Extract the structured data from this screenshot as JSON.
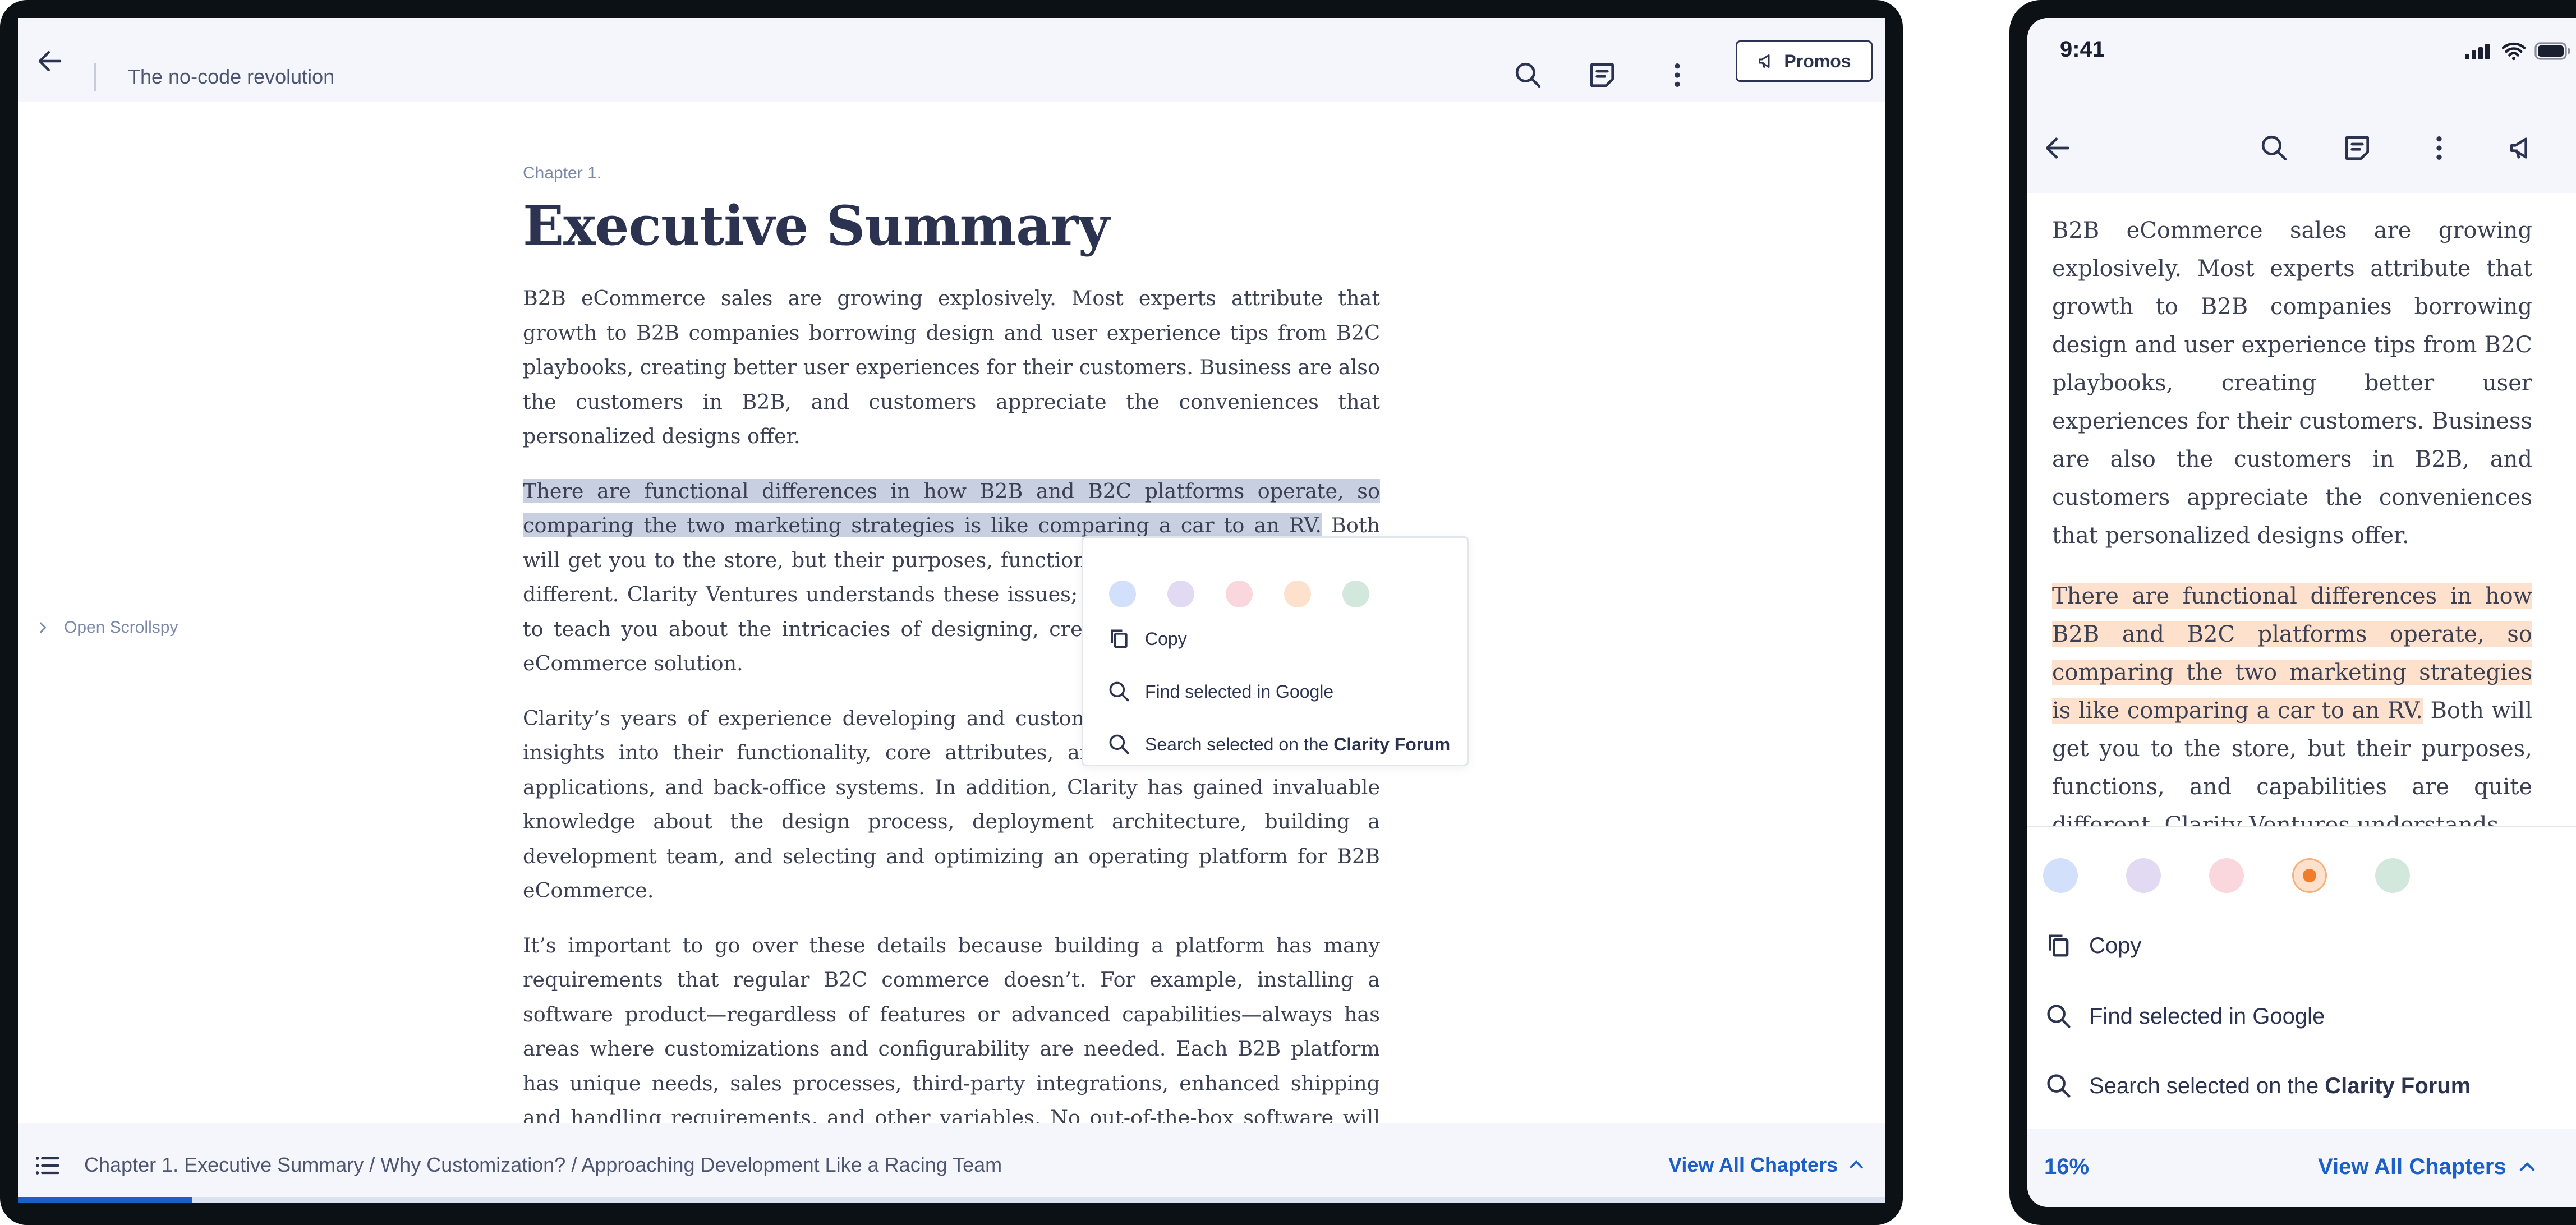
{
  "tablet": {
    "header": {
      "title": "The no-code revolution",
      "promos_label": "Promos",
      "icons": [
        "back-arrow-icon",
        "search-icon",
        "notes-icon",
        "more-vertical-icon",
        "megaphone-icon"
      ]
    },
    "scrollspy_label": "Open Scrollspy",
    "chapter_label": "Chapter 1.",
    "chapter_title": "Executive Summary",
    "paragraphs": {
      "p1": "B2B eCommerce sales are growing explosively. Most experts attribute that growth to B2B companies borrowing design and user experience tips from B2C playbooks, creating better user experiences for their customers. Business are also the customers in B2B, and customers appreciate the conveniences that personalized designs offer.",
      "p2_selected": "There are functional differences in how B2B and B2C platforms operate, so comparing the two marketing strategies is like comparing a car to an RV.",
      "p2_rest": " Both will get you to the store, but their purposes, functions, and capabilities are quite different. Clarity Ventures understands these issues; so, we developed this guide to teach you about the intricacies of designing, creating, and launching a B2B eCommerce solution.",
      "p3": "Clarity’s years of experience developing and customizing software has given it insights into their functionality, core attributes, and integrations with ERPs, applications, and back-office systems. In addition, Clarity has gained invaluable knowledge about the design process, deployment architecture, building a development team, and selecting and optimizing an operating platform for B2B eCommerce.",
      "p4": "It’s important to go over these details because building a platform has many requirements that regular B2C commerce doesn’t. For example, installing a software product—regardless of features or advanced capabilities—always has areas where customizations and configurability are needed. Each B2B platform has unique needs, sales processes, third-party integrations, enhanced shipping and handling requirements, and other variables. No out-of-the-box software will adapt to every business. Only a few of the most basic operations can work within those limitations"
    },
    "context_menu": {
      "colors": [
        "#d3e0fb",
        "#e2d9f3",
        "#f9d7dc",
        "#fde1cc",
        "#d3e8dc"
      ],
      "copy_label": "Copy",
      "google_label": "Find selected in Google",
      "forum_prefix": "Search selected on the ",
      "forum_name": "Clarity Forum"
    },
    "footer": {
      "breadcrumb": "Chapter 1. Executive Summary / Why Customization? / Approaching Development Like a Racing Team",
      "view_all_label": "View All Chapters",
      "progress_fraction": 0.093
    }
  },
  "phone": {
    "status": {
      "time": "9:41"
    },
    "nav_icons": [
      "back-arrow-icon",
      "search-icon",
      "notes-icon",
      "more-vertical-icon",
      "megaphone-icon"
    ],
    "paragraphs": {
      "p1": "B2B eCommerce sales are growing explosively. Most experts attribute that growth to B2B companies borrowing design and user experience tips from B2C playbooks, creating better user experiences for their customers. Business are also the customers in B2B, and customers appreciate the conveniences that personalized designs offer.",
      "p2_highlight": "There are functional differences in how B2B and B2C platforms operate, so comparing the two marketing strategies is like comparing a car to an RV.",
      "p2_rest": " Both will get you to the store, but their purposes, functions, and capabilities are quite different. Clarity Ventures understands"
    },
    "sheet": {
      "colors": [
        "#d3e0fb",
        "#e2d9f3",
        "#f9d7dc",
        "#fde1cc",
        "#d3e8dc"
      ],
      "selected_color_index": 3,
      "copy_label": "Copy",
      "google_label": "Find selected in Google",
      "forum_prefix": "Search selected on the ",
      "forum_name": "Clarity Forum"
    },
    "footer": {
      "percent": "16%",
      "view_all_label": "View All Chapters"
    }
  }
}
